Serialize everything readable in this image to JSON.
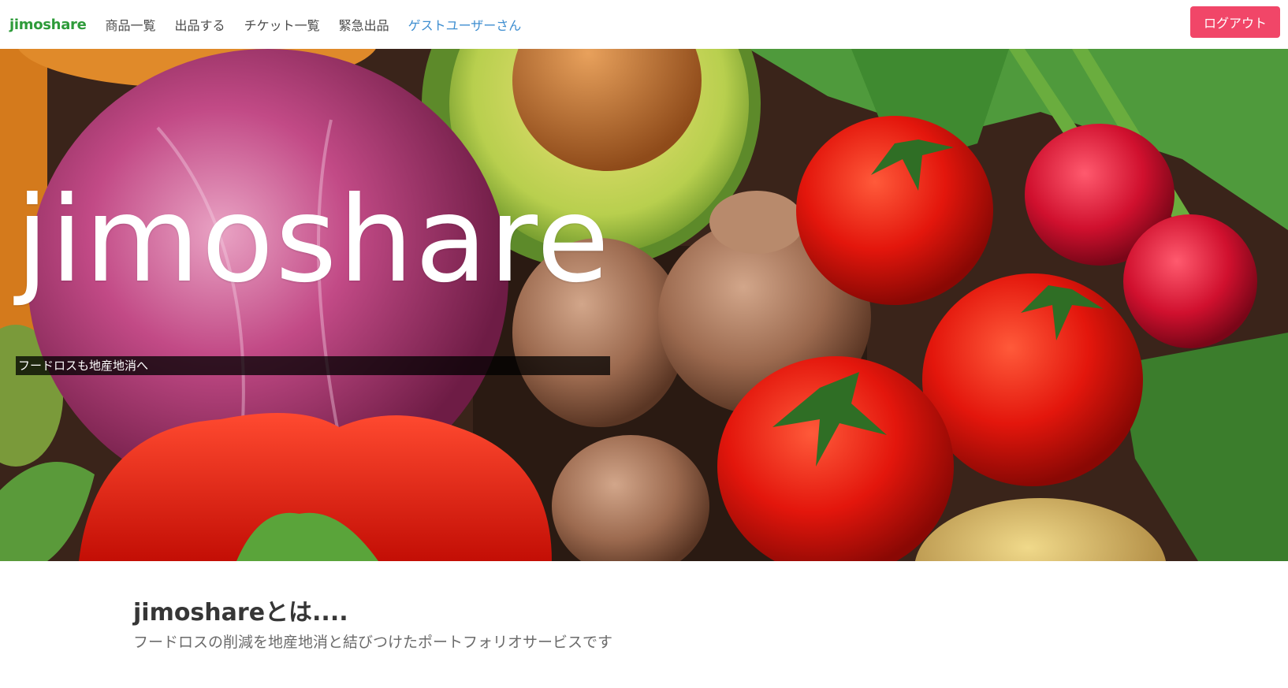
{
  "navbar": {
    "brand": "jimoshare",
    "items": [
      {
        "label": "商品一覧"
      },
      {
        "label": "出品する"
      },
      {
        "label": "チケット一覧"
      },
      {
        "label": "緊急出品"
      }
    ],
    "user_label": "ゲストユーザーさん",
    "logout_label": "ログアウト"
  },
  "hero": {
    "title": "jimoshare",
    "subtitle": "フードロスも地産地消へ"
  },
  "about": {
    "title": "jimoshareとは....",
    "subtitle": "フードロスの削減を地産地消と結びつけたポートフォリオサービスです"
  },
  "colors": {
    "brand": "#2e9b3a",
    "logout_button": "#f14668",
    "user_link": "#3e8ed0"
  }
}
